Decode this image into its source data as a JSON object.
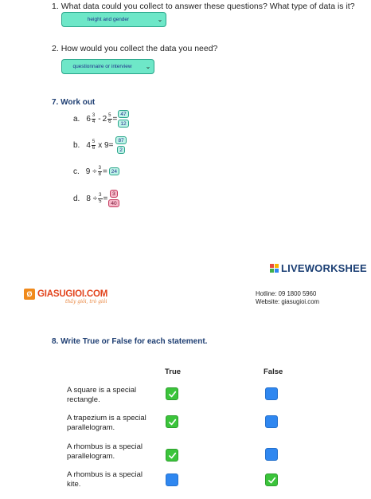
{
  "q1": {
    "number": "1.",
    "text": "What data could you collect to answer these questions? What type of data is it?",
    "selected": "height and gender"
  },
  "q2": {
    "number": "2.",
    "text": "How would you collect the data you need?",
    "selected": "questionnaire or interview"
  },
  "section7": {
    "title": "7.  Work out",
    "items": [
      {
        "label": "a.",
        "whole1": "6",
        "num1": "3",
        "den1": "4",
        "op": "-",
        "whole2": "2",
        "num2": "5",
        "den2": "6",
        "ans_num": "47",
        "ans_den": "12",
        "state": "correct"
      },
      {
        "label": "b.",
        "whole1": "4",
        "num1": "5",
        "den1": "6",
        "op": "x 9=",
        "ans_num": "87",
        "ans_den": "2",
        "state": "correct"
      },
      {
        "label": "c.",
        "whole1": "9 ÷",
        "num1": "3",
        "den1": "8",
        "ans": "24",
        "state": "correct"
      },
      {
        "label": "d.",
        "whole1": "8 ÷",
        "num1": "3",
        "den1": "5",
        "ans_num": "3",
        "ans_den": "40",
        "state": "wrong"
      }
    ]
  },
  "liveworksheets": {
    "text": "LIVEWORKSHEE"
  },
  "giasugioi": {
    "name": "GIASUGIOI.COM",
    "tagline": "thầy giỏi, trò giỏi",
    "hotline": "Hotline: 09 1800 5960",
    "website": "Website: giasugioi.com"
  },
  "section8": {
    "title": "8.  Write True or False for each statement.",
    "col_true": "True",
    "col_false": "False",
    "rows": [
      {
        "line1": "A square is a special",
        "line2": "rectangle.",
        "true_checked": true,
        "false_checked": false
      },
      {
        "line1": "A trapezium is a special",
        "line2": "parallelogram.",
        "true_checked": true,
        "false_checked": false
      },
      {
        "line1": "A rhombus is a special",
        "line2": "parallelogram.",
        "true_checked": true,
        "false_checked": false
      },
      {
        "line1": "A rhombus is a special",
        "line2": "kite.",
        "true_checked": false,
        "false_checked": true
      }
    ]
  },
  "colors": {
    "select_bg": "#6ee7c8",
    "correct": "#bff3e8",
    "wrong": "#f6b8c9",
    "heading": "#1f3f73",
    "check_green": "#3bc43b",
    "box_blue": "#2f87f0"
  }
}
